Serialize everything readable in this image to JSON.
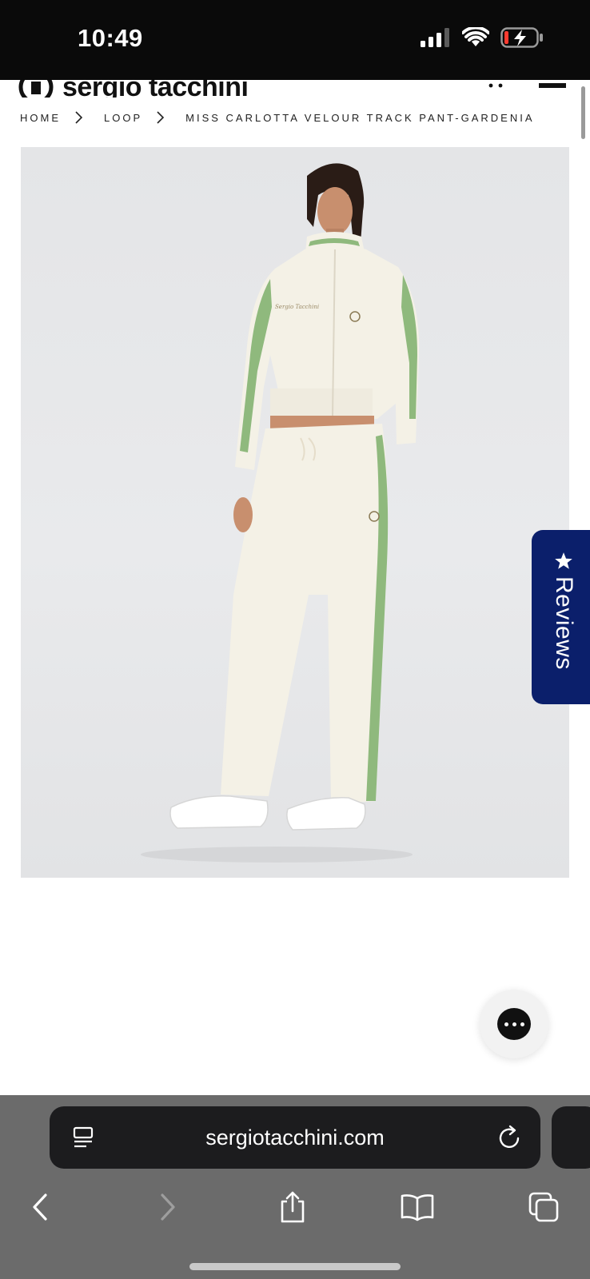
{
  "status_bar": {
    "time": "10:49"
  },
  "site": {
    "logo_text": "sergio tacchini"
  },
  "breadcrumb": {
    "items": [
      "HOME",
      "LOOP",
      "MISS CARLOTTA VELOUR TRACK PANT-GARDENIA"
    ]
  },
  "product": {
    "jacket_script": "Sergio Tacchini"
  },
  "reviews_tab": {
    "label": "Reviews",
    "icon": "star-icon"
  },
  "chat": {
    "icon": "chat-bubble-icon"
  },
  "browser": {
    "url": "sergiotacchini.com",
    "toolbar": [
      "back-icon",
      "forward-icon",
      "share-icon",
      "bookmarks-icon",
      "tabs-icon"
    ]
  },
  "colors": {
    "status_bar_bg": "#0a0a0a",
    "reviews_bg": "#0b1f6b",
    "stripe_green": "#8fb97d",
    "garment_cream": "#f4f1e6",
    "browser_bar": "#6b6b6b"
  }
}
